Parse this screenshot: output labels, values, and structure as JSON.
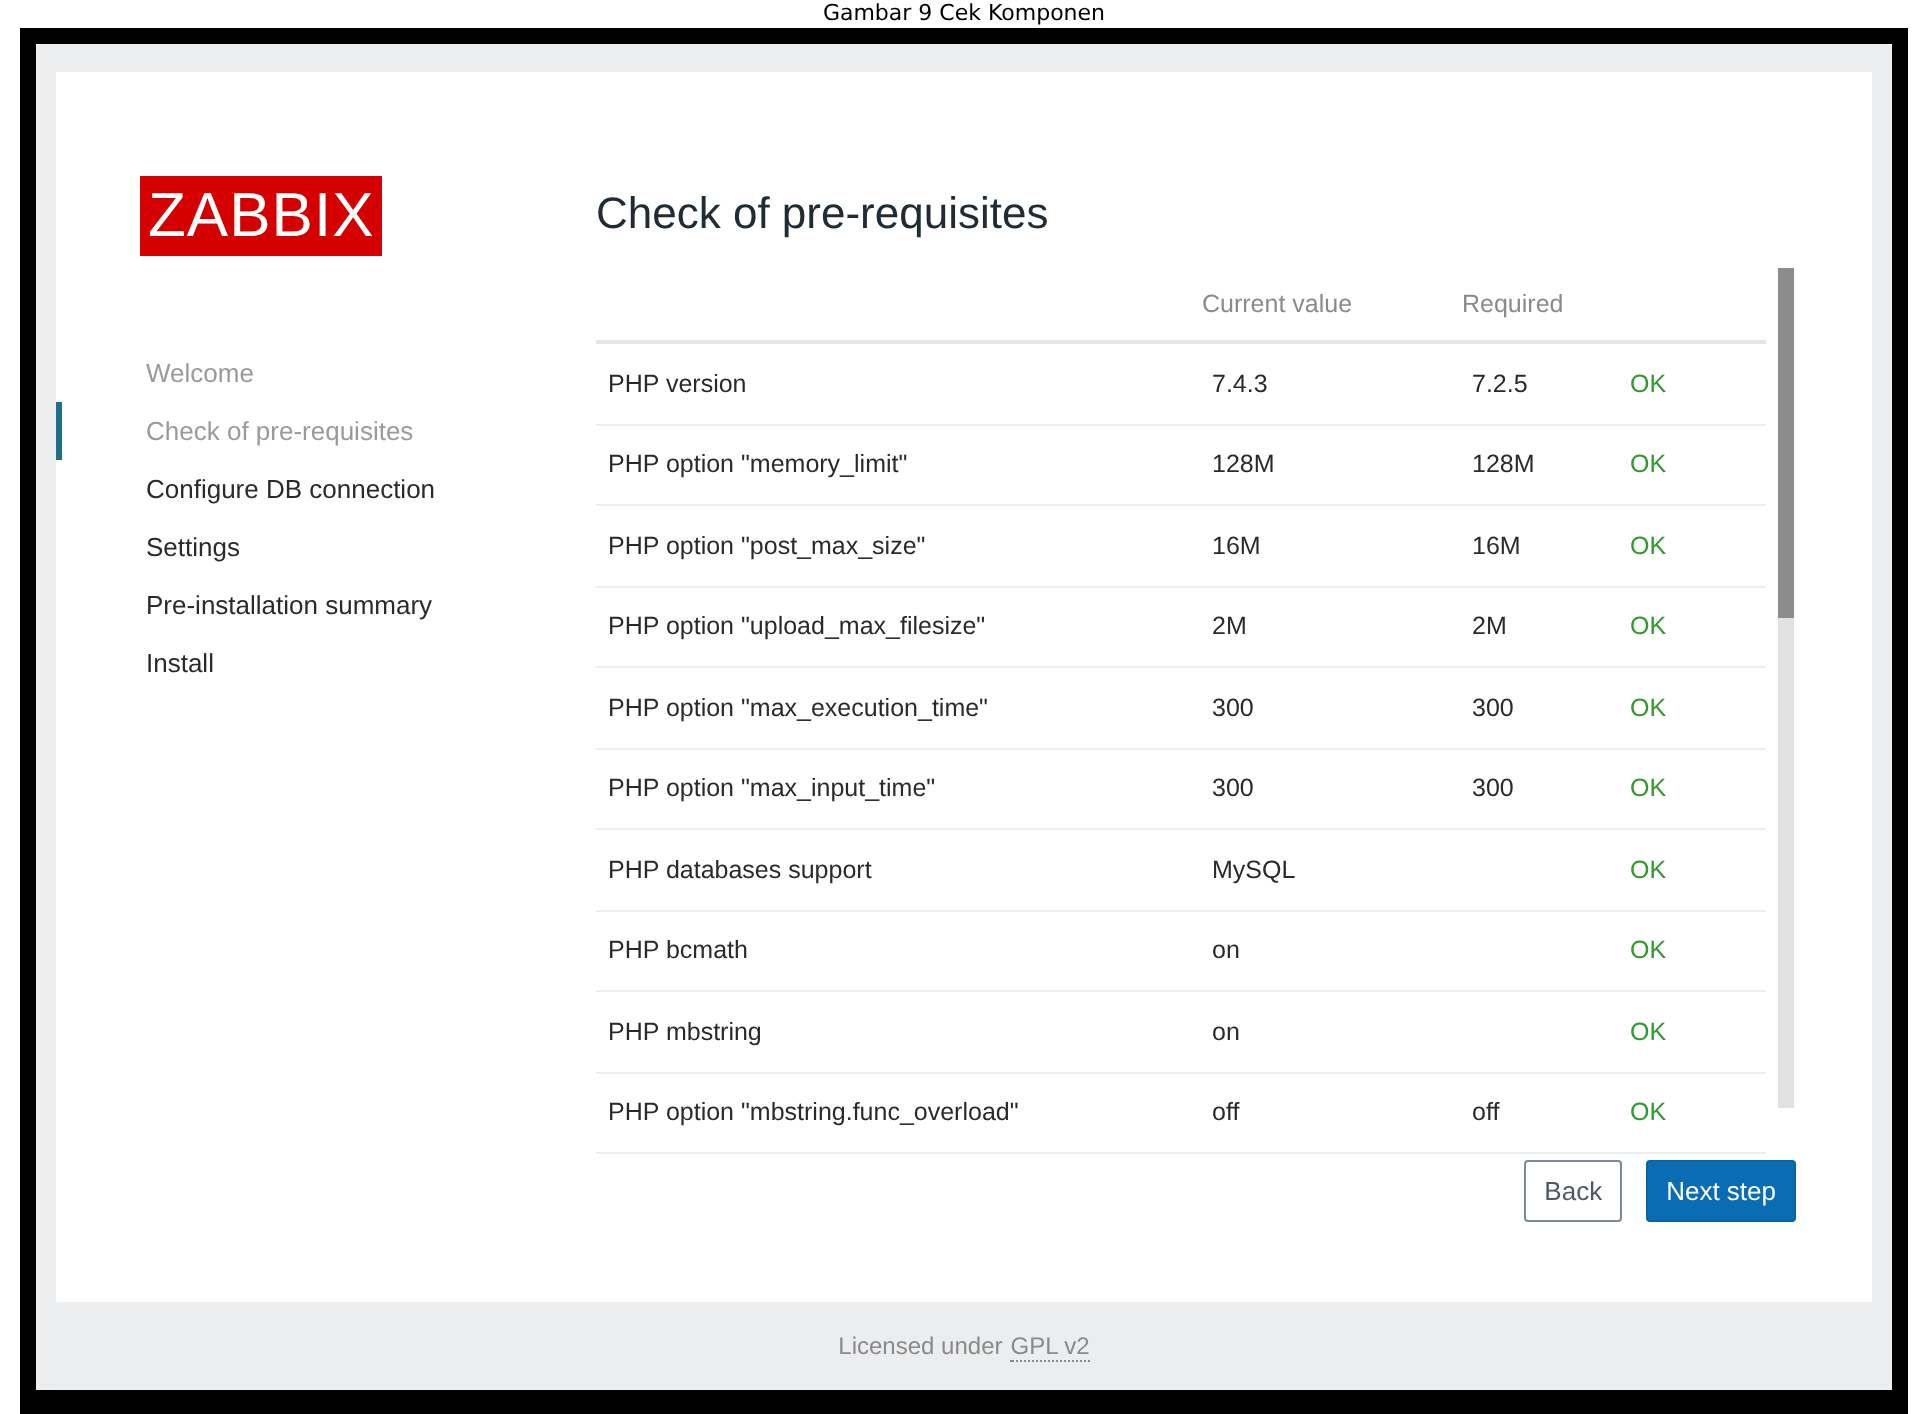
{
  "caption": "Gambar 9 Cek Komponen",
  "logo": "ZABBIX",
  "steps": [
    {
      "label": "Welcome",
      "done": true,
      "selected": false
    },
    {
      "label": "Check of pre-requisites",
      "done": true,
      "selected": true
    },
    {
      "label": "Configure DB connection",
      "done": false,
      "selected": false
    },
    {
      "label": "Settings",
      "done": false,
      "selected": false
    },
    {
      "label": "Pre-installation summary",
      "done": false,
      "selected": false
    },
    {
      "label": "Install",
      "done": false,
      "selected": false
    }
  ],
  "title": "Check of pre-requisites",
  "table": {
    "columns": [
      "Current value",
      "Required"
    ],
    "rows": [
      {
        "name": "PHP version",
        "current": "7.4.3",
        "required": "7.2.5",
        "status": "OK"
      },
      {
        "name": "PHP option \"memory_limit\"",
        "current": "128M",
        "required": "128M",
        "status": "OK"
      },
      {
        "name": "PHP option \"post_max_size\"",
        "current": "16M",
        "required": "16M",
        "status": "OK"
      },
      {
        "name": "PHP option \"upload_max_filesize\"",
        "current": "2M",
        "required": "2M",
        "status": "OK"
      },
      {
        "name": "PHP option \"max_execution_time\"",
        "current": "300",
        "required": "300",
        "status": "OK"
      },
      {
        "name": "PHP option \"max_input_time\"",
        "current": "300",
        "required": "300",
        "status": "OK"
      },
      {
        "name": "PHP databases support",
        "current": "MySQL",
        "status": "OK"
      },
      {
        "name": "PHP bcmath",
        "current": "on",
        "status": "OK"
      },
      {
        "name": "PHP mbstring",
        "current": "on",
        "status": "OK"
      },
      {
        "name": "PHP option \"mbstring.func_overload\"",
        "current": "off",
        "required": "off",
        "status": "OK"
      }
    ]
  },
  "buttons": [
    {
      "label": "Back",
      "kind": "secondary"
    },
    {
      "label": "Next step",
      "kind": "primary"
    }
  ],
  "footer": {
    "text": "Licensed under",
    "link": "GPL v2"
  }
}
